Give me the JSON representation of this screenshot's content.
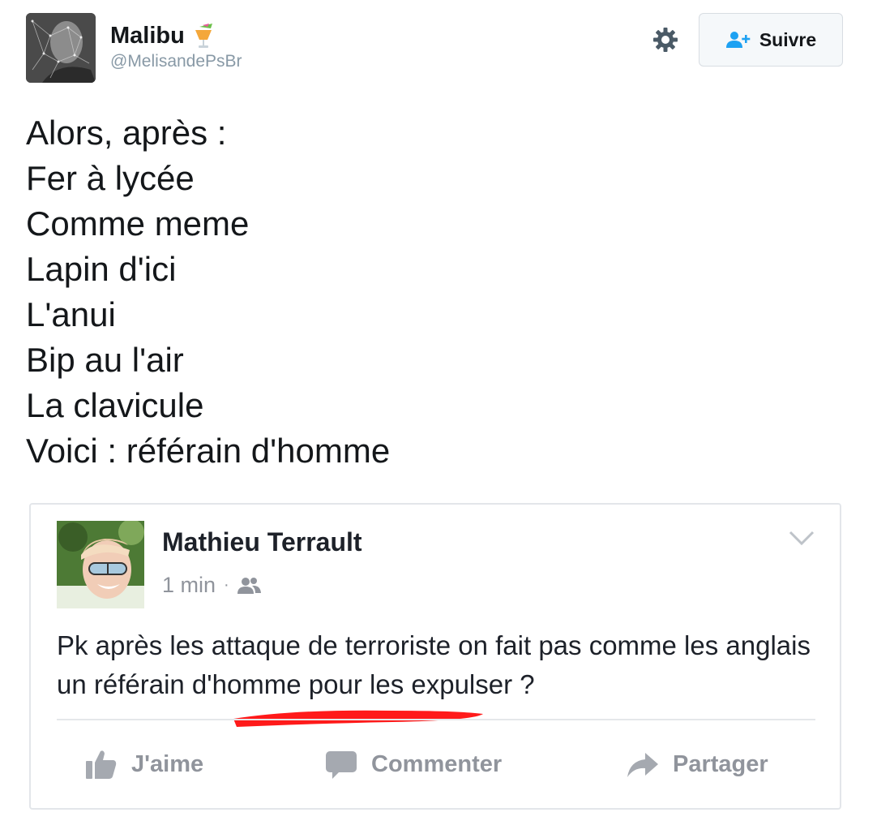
{
  "tweet": {
    "author": {
      "display_name": "Malibu",
      "emoji": "tropical-drink",
      "handle": "@MelisandePsBr"
    },
    "follow_button": {
      "label": "Suivre"
    },
    "text_lines": [
      "Alors, après :",
      "Fer à lycée",
      "Comme meme",
      "Lapin d'ici",
      "L'anui",
      "Bip au l'air",
      "La clavicule",
      "Voici : référain d'homme"
    ],
    "colors": {
      "accent": "#1da1f2",
      "text": "#14171a",
      "muted": "#8899a6"
    }
  },
  "embedded_post": {
    "author": "Mathieu Terrault",
    "time": "1 min",
    "separator": "·",
    "audience_icon": "friends-icon",
    "text": "Pk après les attaque de terroriste on fait pas comme les anglais un référain d'homme pour les expulser ?",
    "highlight_color": "#ff1a1a",
    "actions": [
      {
        "label": "J'aime",
        "icon": "thumbs-up-icon"
      },
      {
        "label": "Commenter",
        "icon": "comment-icon"
      },
      {
        "label": "Partager",
        "icon": "share-arrow-icon"
      }
    ]
  }
}
